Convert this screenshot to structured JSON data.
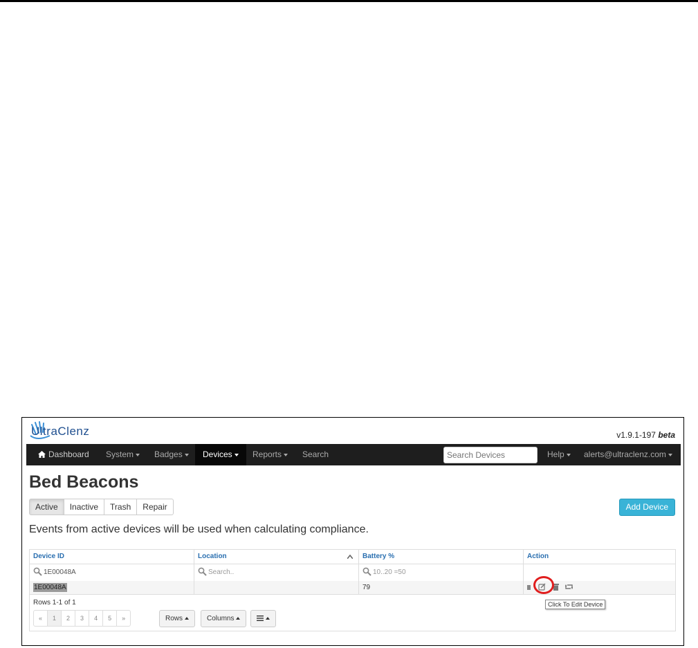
{
  "brand": {
    "logo_text": "UltraClenz",
    "version": "v1.9.1-197",
    "version_tag": "beta"
  },
  "nav": {
    "items": [
      {
        "label": "Dashboard",
        "icon": "home-icon"
      },
      {
        "label": "System"
      },
      {
        "label": "Badges"
      },
      {
        "label": "Devices",
        "active": true
      },
      {
        "label": "Reports"
      },
      {
        "label": "Search"
      }
    ],
    "search_placeholder": "Search Devices",
    "help": "Help",
    "account": "alerts@ultraclenz.com"
  },
  "page": {
    "title": "Bed Beacons",
    "tabs": [
      "Active",
      "Inactive",
      "Trash",
      "Repair"
    ],
    "active_tab": "Active",
    "add_button": "Add Device",
    "info_text": "Events from active devices will be used when calculating compliance."
  },
  "table": {
    "headers": [
      "Device ID",
      "Location",
      "Battery %",
      "Action"
    ],
    "filters": {
      "device_id": "1E00048A",
      "location": "Search..",
      "battery": "10..20 =50"
    },
    "rows": [
      {
        "device_id": "1E00048A",
        "location": "",
        "battery": "79"
      }
    ],
    "action_icons": [
      "stop-icon",
      "edit-icon",
      "trash-icon",
      "retweet-icon"
    ],
    "tooltip": "Click To Edit Device",
    "rows_info": "Rows 1-1 of 1",
    "pages": [
      "«",
      "1",
      "2",
      "3",
      "4",
      "5",
      "»"
    ],
    "rows_button": "Rows",
    "columns_button": "Columns"
  },
  "colors": {
    "navbar": "#1e1e1e",
    "accent": "#39b3d7",
    "header_text": "#2a6fb0",
    "highlight_circle": "#e01e1e"
  }
}
